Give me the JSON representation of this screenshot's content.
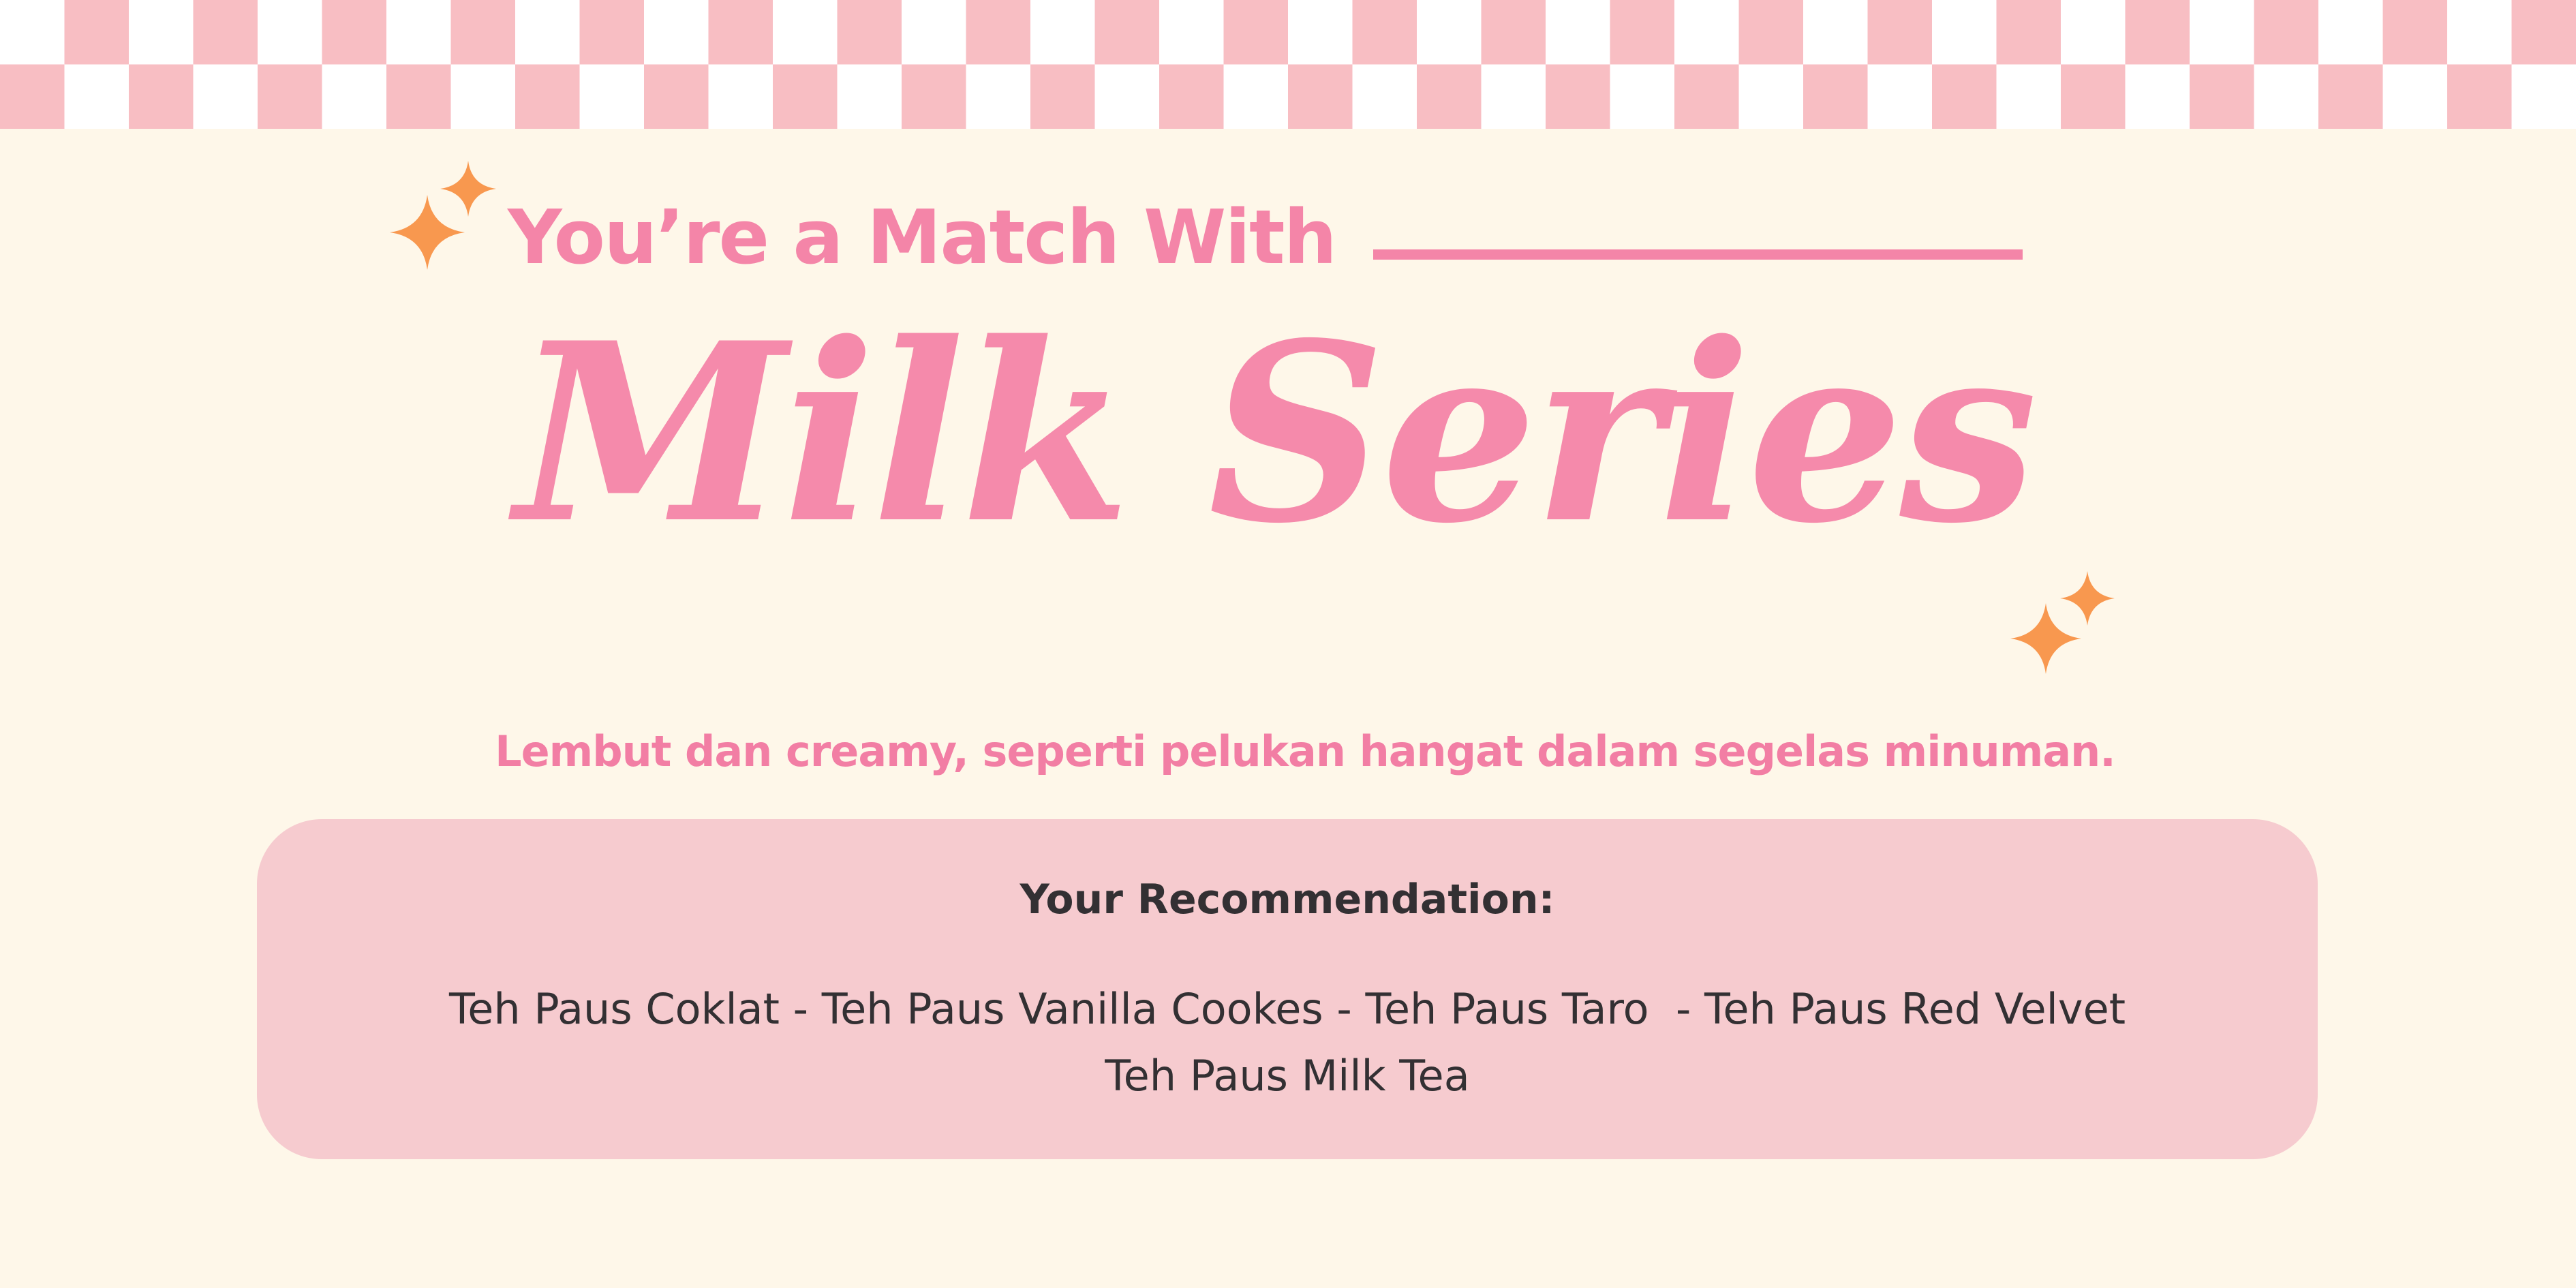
{
  "colors": {
    "background": "#fef7e9",
    "checker_pink": "#f8bec3",
    "heading_pink": "#f485a8",
    "card_pink": "#f6cbcf",
    "sparkle_orange": "#f8984f",
    "text_dark": "#333033"
  },
  "header": {
    "match_text": "You’re a Match With"
  },
  "series": {
    "title": "Milk Series",
    "tagline": "Lembut dan creamy, seperti pelukan hangat dalam segelas minuman."
  },
  "recommendation": {
    "heading": "Your Recommendation:",
    "line_1": "Teh Paus Coklat - Teh Paus Vanilla Cookes - Teh Paus Taro  - Teh Paus Red Velvet",
    "line_2": "Teh Paus Milk Tea"
  },
  "decorations": {
    "checker_pattern": "pink-white-checkerboard",
    "sparkle_icon": "four-point-star-sparkle"
  }
}
